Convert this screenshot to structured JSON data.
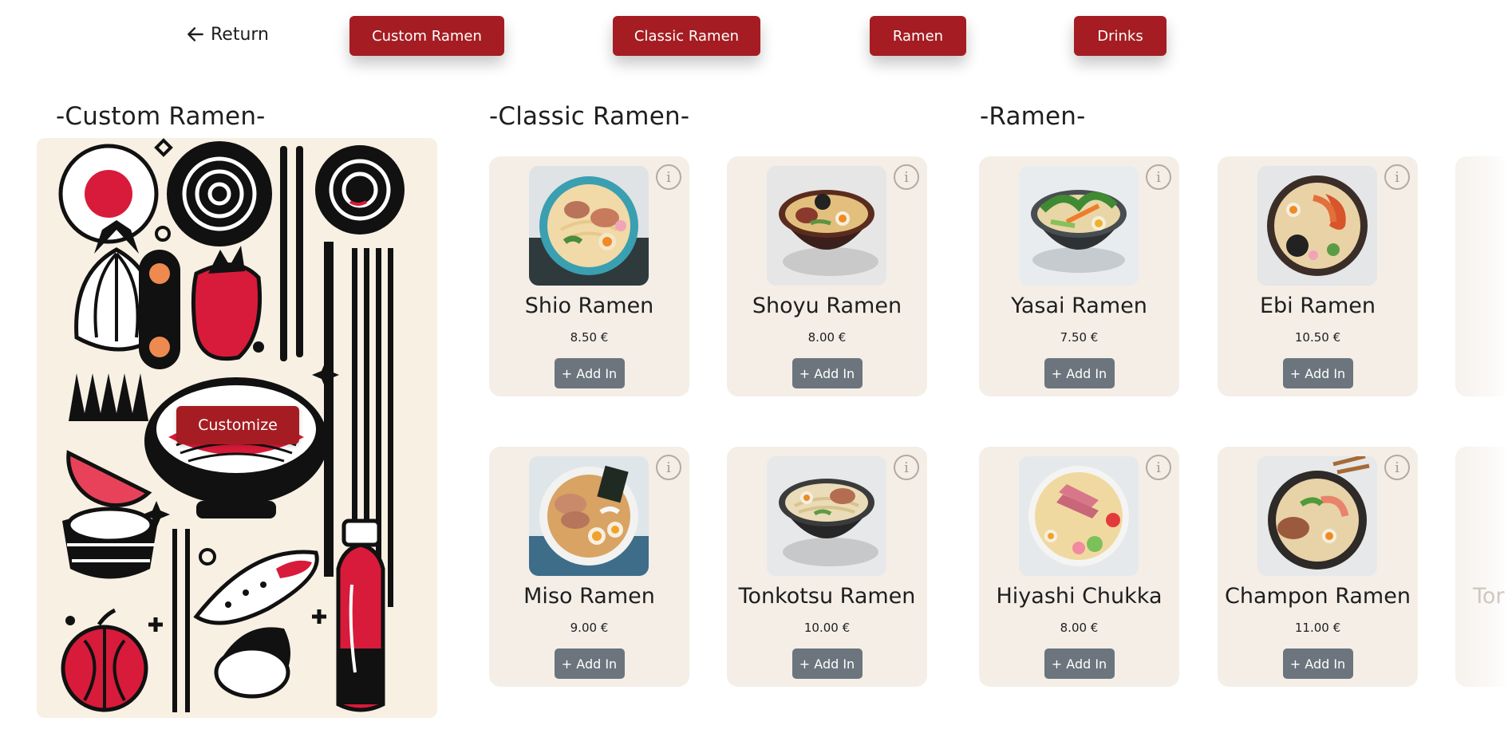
{
  "header": {
    "return_label": "Return",
    "nav": [
      {
        "label": "Custom Ramen"
      },
      {
        "label": "Classic Ramen"
      },
      {
        "label": "Ramen"
      },
      {
        "label": "Drinks"
      }
    ]
  },
  "sections": {
    "custom": {
      "title": "-Custom Ramen-",
      "button_label": "Customize"
    },
    "classic": {
      "title": "-Classic Ramen-"
    },
    "ramen": {
      "title": "-Ramen-"
    }
  },
  "add_label": "+ Add In",
  "info_glyph": "i",
  "items": [
    {
      "name": "Shio Ramen",
      "price": "8.50 €"
    },
    {
      "name": "Shoyu Ramen",
      "price": "8.00 €"
    },
    {
      "name": "Yasai Ramen",
      "price": "7.50 €"
    },
    {
      "name": "Ebi Ramen",
      "price": "10.50 €"
    },
    {
      "name": "Miso Ramen",
      "price": "9.00 €"
    },
    {
      "name": "Tonkotsu Ramen",
      "price": "10.00 €"
    },
    {
      "name": "Hiyashi Chukka",
      "price": "8.00 €"
    },
    {
      "name": "Champon Ramen",
      "price": "11.00 €"
    }
  ],
  "partial_item": {
    "name_fragment": "Tor"
  },
  "colors": {
    "accent": "#a51d22",
    "card": "#f4eee7",
    "add_button": "#6c757d",
    "panel": "#f7f0e3"
  }
}
